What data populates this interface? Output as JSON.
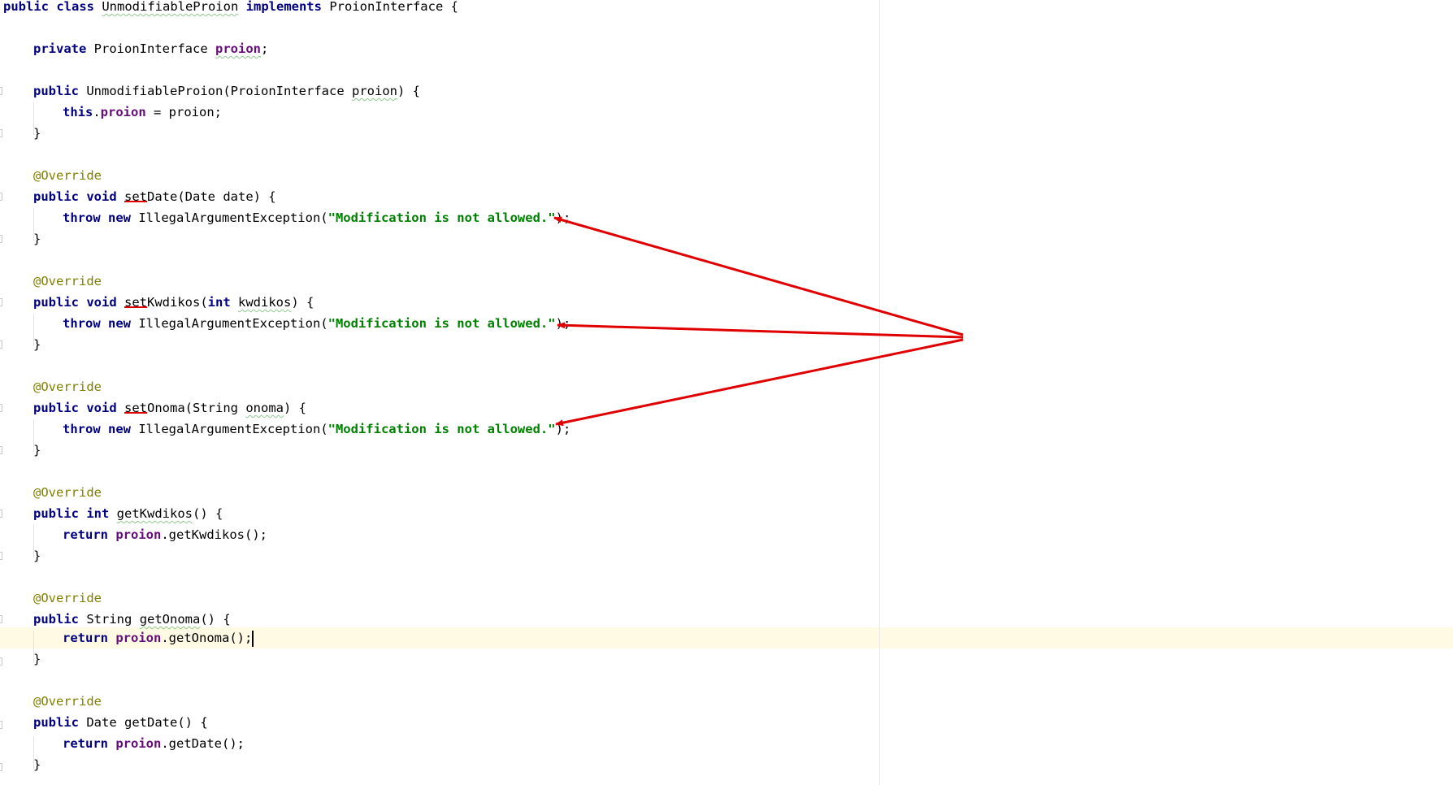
{
  "editor": {
    "class_decl": {
      "kw": "public class",
      "name": "UnmodifiableProion",
      "kw2": "implements",
      "iface": "ProionInterface",
      "brace": "{"
    },
    "field_decl": {
      "kw": "private",
      "type": "ProionInterface",
      "name": "proion",
      "end": ";"
    },
    "ctor": {
      "kw": "public",
      "name": "UnmodifiableProion",
      "open": "(",
      "ptype": "ProionInterface",
      "pname": "proion",
      "close": ") {",
      "body_kw": "this",
      "body_dot": ".",
      "body_field": "proion",
      "body_rest": " = proion;",
      "end": "}"
    },
    "annotation": "@Override",
    "close_brace": "}",
    "setDate": {
      "kw": "public void",
      "set": "set",
      "rest": "Date(Date date) {",
      "throw_kw": "throw new",
      "exc": "IllegalArgumentException(",
      "msg": "\"Modification is not allowed.\"",
      "end": ");"
    },
    "setKwdikos": {
      "kw": "public void",
      "set": "set",
      "rest1": "Kwdikos(",
      "int_kw": "int",
      "pname": "kwdikos",
      "rest2": ") {",
      "throw_kw": "throw new",
      "exc": "IllegalArgumentException(",
      "msg": "\"Modification is not allowed.\"",
      "end": ");"
    },
    "setOnoma": {
      "kw": "public void",
      "set": "set",
      "rest1": "Onoma(String ",
      "pname": "onoma",
      "rest2": ") {",
      "throw_kw": "throw new",
      "exc": "IllegalArgumentException(",
      "msg": "\"Modification is not allowed.\"",
      "end": ");"
    },
    "getKwdikos": {
      "kw": "public int",
      "name": "getKwdikos",
      "rest": "() {",
      "ret_kw": "return",
      "field": "proion",
      "call": ".getKwdikos();"
    },
    "getOnoma": {
      "kw": "public",
      "type": "String",
      "name": "getOnoma",
      "rest": "() {",
      "ret_kw": "return",
      "field": "proion",
      "call": ".getOnoma();"
    },
    "getDate": {
      "kw": "public",
      "type": "Date getDate() {",
      "ret_kw": "return",
      "field": "proion",
      "call": ".getDate();"
    }
  },
  "colors": {
    "keyword": "#000080",
    "field": "#660e7a",
    "string": "#008000",
    "annotation": "#808000",
    "arrow": "#e00000",
    "caret_row": "#fffae3"
  }
}
